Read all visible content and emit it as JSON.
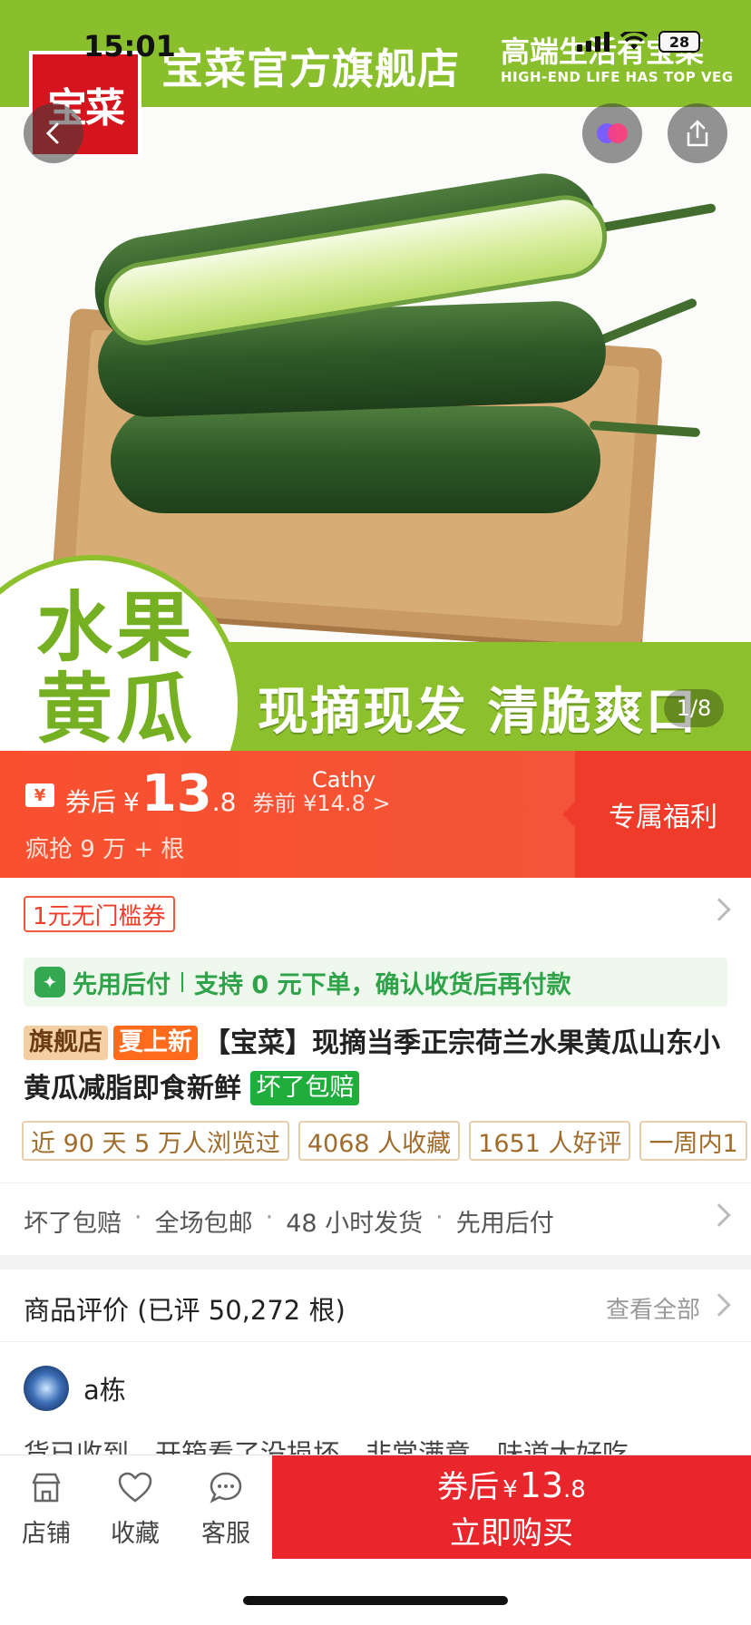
{
  "status_bar": {
    "time": "15:01",
    "battery": "28"
  },
  "banner": {
    "logo_text": "宝菜",
    "store_name": "宝菜官方旗舰店",
    "slogan": "高端生活有宝菜",
    "slogan_en": "HIGH-END LIFE HAS TOP VEG",
    "badge_line1": "水果",
    "badge_line2": "黄瓜",
    "tagline": "现摘现发 清脆爽口",
    "page_indicator": "1/8"
  },
  "price": {
    "after_label": "券后",
    "currency": "¥",
    "price_int": "13",
    "price_dec": ".8",
    "before_text": "券前 ¥14.8 >",
    "sales_text": "疯抢 9 万 + 根",
    "side_label": "专属福利",
    "user_tag": "Cathy"
  },
  "coupon": {
    "label": "1元无门槛券"
  },
  "paylater": {
    "icon": "pay-later-icon",
    "label": "先用后付",
    "desc": "支持 0 元下单，确认收货后再付款"
  },
  "title": {
    "chip_flagship": "旗舰店",
    "chip_summer": "夏上新",
    "text": "【宝菜】现摘当季正宗荷兰水果黄瓜山东小黄瓜减脂即食新鲜",
    "chip_guarantee": "坏了包赔"
  },
  "stats": [
    "近 90 天 5 万人浏览过",
    "4068 人收藏",
    "1651 人好评",
    "一周内1"
  ],
  "services": [
    "坏了包赔",
    "全场包邮",
    "48 小时发货",
    "先用后付"
  ],
  "reviews": {
    "title": "商品评价 (已评 50,272 根)",
    "view_all": "查看全部",
    "reviewer_name": "a栋",
    "text": "货已收到，开箱看了没损坏，非常满意，味道太好吃"
  },
  "bottom": {
    "store": "店铺",
    "favorite": "收藏",
    "service": "客服",
    "buy_after": "券后",
    "buy_currency": "¥",
    "buy_price_int": "13",
    "buy_price_dec": ".8",
    "buy_now": "立即购买"
  },
  "colors": {
    "brand_green": "#8cc12d",
    "price_orange": "#f8502f",
    "buy_red": "#e8262b",
    "paylater_green": "#2fa34a"
  }
}
